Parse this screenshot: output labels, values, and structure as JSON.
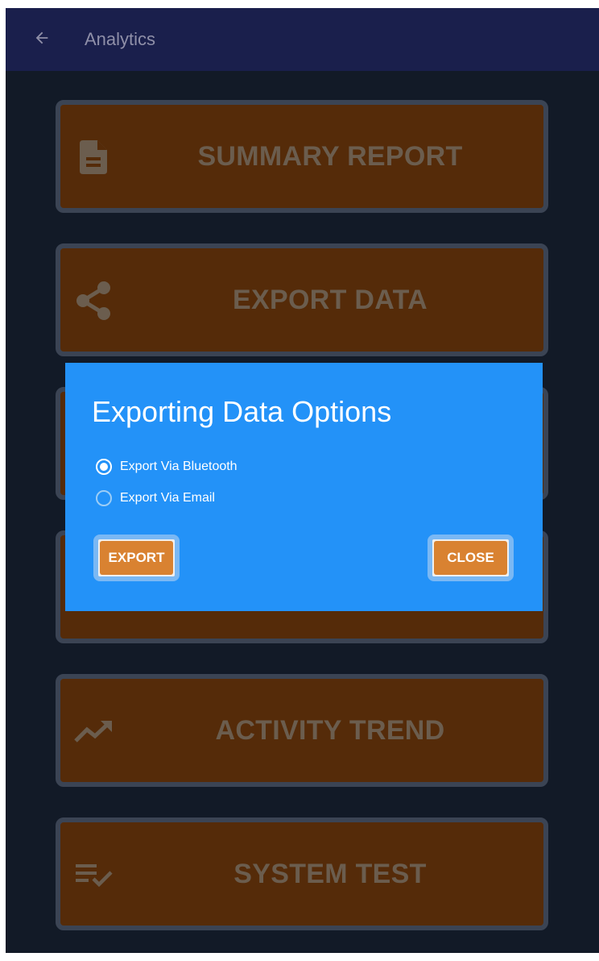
{
  "appbar": {
    "title": "Analytics",
    "back_icon": "arrow-left-icon"
  },
  "menu": {
    "items": [
      {
        "label": "SUMMARY REPORT",
        "icon": "document-icon"
      },
      {
        "label": "EXPORT DATA",
        "icon": "share-icon"
      },
      {
        "label": "",
        "icon": ""
      },
      {
        "label": "",
        "icon": ""
      },
      {
        "label": "ACTIVITY TREND",
        "icon": "trending-up-icon"
      },
      {
        "label": "SYSTEM TEST",
        "icon": "checklist-icon"
      }
    ]
  },
  "dialog": {
    "title": "Exporting Data Options",
    "options": [
      {
        "label": "Export Via Bluetooth",
        "selected": true
      },
      {
        "label": "Export Via Email",
        "selected": false
      }
    ],
    "export_label": "EXPORT",
    "close_label": "CLOSE"
  },
  "colors": {
    "background": "#121a27",
    "appbar": "#1a1f4c",
    "menu_item": "#552b09",
    "menu_border": "#3b4454",
    "dialog": "#2392f8",
    "dialog_button": "#d98231"
  }
}
